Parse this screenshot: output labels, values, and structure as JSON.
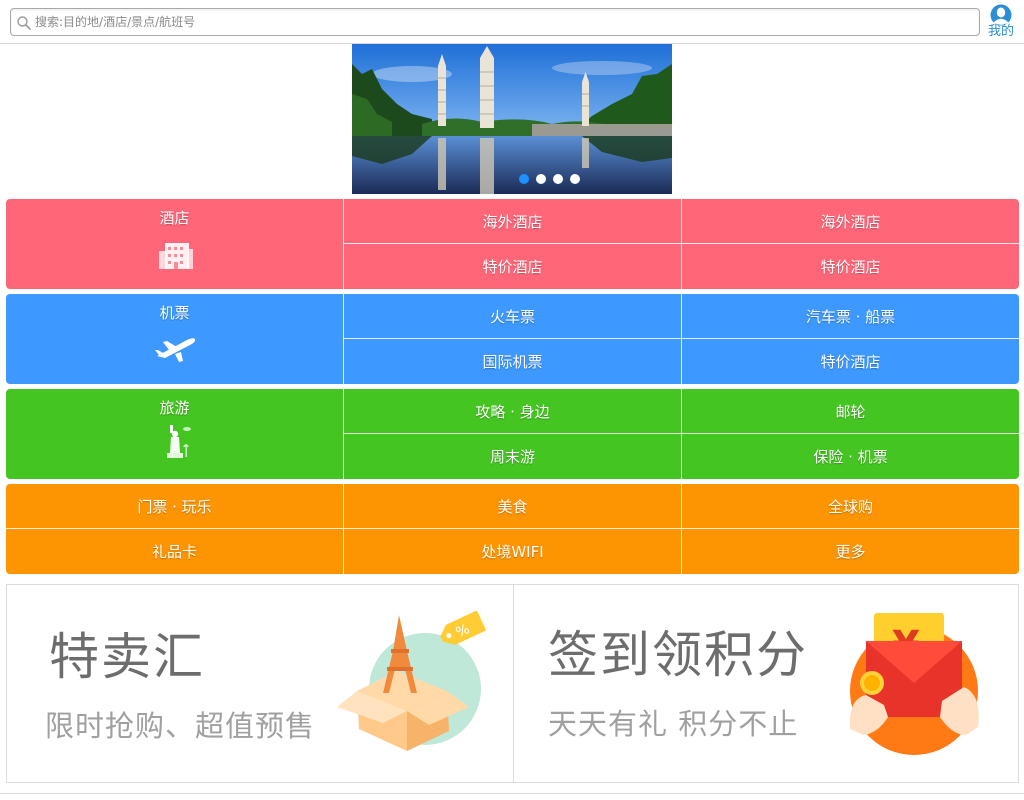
{
  "search": {
    "placeholder": "搜索:目的地/酒店/景点/航班号"
  },
  "account": {
    "label": "我的"
  },
  "banner": {
    "slide_count": 4,
    "active_index": 0
  },
  "grid": {
    "hotel": {
      "main": "酒店",
      "c1": "海外酒店",
      "c2": "海外酒店",
      "c3": "特价酒店",
      "c4": "特价酒店",
      "color": "#ff6678"
    },
    "flight": {
      "main": "机票",
      "c1": "火车票",
      "c2": "汽车票 · 船票",
      "c3": "国际机票",
      "c4": "特价酒店",
      "color": "#3d98ff"
    },
    "travel": {
      "main": "旅游",
      "c1": "攻略 · 身边",
      "c2": "邮轮",
      "c3": "周末游",
      "c4": "保险 · 机票",
      "color": "#44c522"
    },
    "ticket": {
      "c1": "门票 · 玩乐",
      "c2": "美食",
      "c3": "全球购",
      "c4": "礼品卡",
      "c5": "处境WIFI",
      "c6": "更多",
      "color": "#fd9402"
    }
  },
  "promo": {
    "left": {
      "title": "特卖汇",
      "subtitle": "限时抢购、超值预售"
    },
    "right": {
      "title": "签到领积分",
      "subtitle": "天天有礼 积分不止"
    }
  }
}
